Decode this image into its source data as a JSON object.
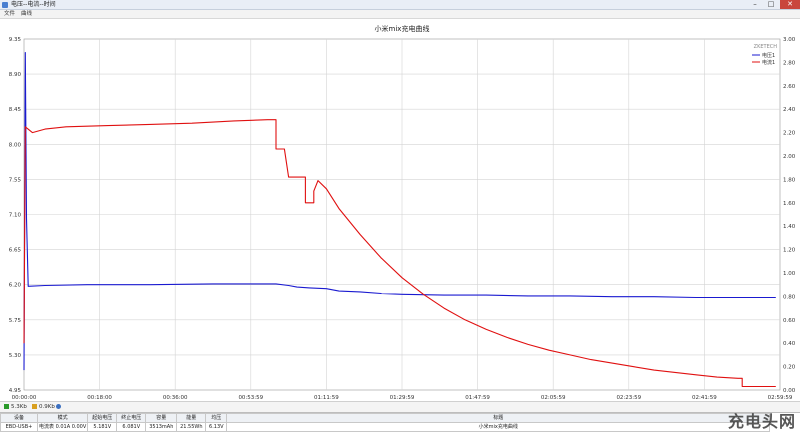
{
  "window": {
    "title": "电压--电流--时间",
    "close_glyph": "✕",
    "minimize_glyph": "–",
    "maximize_glyph": "□"
  },
  "menu": {
    "items": [
      "文件",
      "曲线"
    ]
  },
  "chart_data": {
    "type": "line",
    "title": "小米mix充电曲线",
    "brand": "ZKETECH",
    "x_ticks": [
      "00:00:00",
      "00:18:00",
      "00:36:00",
      "00:53:59",
      "01:11:59",
      "01:29:59",
      "01:47:59",
      "02:05:59",
      "02:23:59",
      "02:41:59",
      "02:59:59"
    ],
    "xlim_minutes": [
      0,
      180
    ],
    "y_left": {
      "ticks": [
        "9.35",
        "8.90",
        "8.45",
        "8.00",
        "7.55",
        "7.10",
        "6.65",
        "6.20",
        "5.75",
        "5.30",
        "4.95"
      ],
      "ylim": [
        4.95,
        9.35
      ]
    },
    "y_right": {
      "ticks": [
        "3.00",
        "2.80",
        "2.60",
        "2.40",
        "2.20",
        "2.00",
        "1.80",
        "1.60",
        "1.40",
        "1.20",
        "1.00",
        "0.80",
        "0.60",
        "0.40",
        "0.20",
        "0.00"
      ],
      "ylim": [
        0,
        3.0
      ]
    },
    "grid": true,
    "legend_position": "top-right",
    "series": [
      {
        "name": "电压1",
        "axis": "left",
        "color": "#1a1ad0",
        "points": [
          [
            0,
            5.2
          ],
          [
            0.3,
            9.18
          ],
          [
            0.6,
            7.1
          ],
          [
            1,
            6.25
          ],
          [
            5,
            6.26
          ],
          [
            15,
            6.27
          ],
          [
            30,
            6.27
          ],
          [
            45,
            6.28
          ],
          [
            55,
            6.28
          ],
          [
            60,
            6.28
          ],
          [
            63,
            6.26
          ],
          [
            65,
            6.24
          ],
          [
            68,
            6.23
          ],
          [
            72,
            6.22
          ],
          [
            75,
            6.19
          ],
          [
            80,
            6.18
          ],
          [
            85,
            6.16
          ],
          [
            90,
            6.15
          ],
          [
            100,
            6.14
          ],
          [
            110,
            6.14
          ],
          [
            120,
            6.13
          ],
          [
            130,
            6.13
          ],
          [
            140,
            6.12
          ],
          [
            150,
            6.12
          ],
          [
            160,
            6.11
          ],
          [
            170,
            6.11
          ],
          [
            179,
            6.11
          ]
        ]
      },
      {
        "name": "电流1",
        "axis": "right",
        "color": "#e01010",
        "points": [
          [
            0,
            0.4
          ],
          [
            0.3,
            2.25
          ],
          [
            2,
            2.2
          ],
          [
            5,
            2.23
          ],
          [
            10,
            2.25
          ],
          [
            20,
            2.26
          ],
          [
            30,
            2.27
          ],
          [
            40,
            2.28
          ],
          [
            50,
            2.3
          ],
          [
            58,
            2.31
          ],
          [
            60,
            2.31
          ],
          [
            60,
            2.06
          ],
          [
            62,
            2.06
          ],
          [
            63,
            1.82
          ],
          [
            67,
            1.82
          ],
          [
            67,
            1.6
          ],
          [
            69,
            1.6
          ],
          [
            69,
            1.7
          ],
          [
            70,
            1.79
          ],
          [
            72,
            1.72
          ],
          [
            75,
            1.55
          ],
          [
            80,
            1.33
          ],
          [
            85,
            1.13
          ],
          [
            90,
            0.96
          ],
          [
            95,
            0.82
          ],
          [
            100,
            0.7
          ],
          [
            105,
            0.6
          ],
          [
            110,
            0.52
          ],
          [
            115,
            0.45
          ],
          [
            120,
            0.39
          ],
          [
            125,
            0.34
          ],
          [
            130,
            0.3
          ],
          [
            135,
            0.26
          ],
          [
            140,
            0.23
          ],
          [
            145,
            0.2
          ],
          [
            150,
            0.17
          ],
          [
            155,
            0.15
          ],
          [
            160,
            0.13
          ],
          [
            165,
            0.11
          ],
          [
            170,
            0.1
          ],
          [
            171,
            0.1
          ],
          [
            171,
            0.03
          ],
          [
            179,
            0.03
          ]
        ]
      }
    ]
  },
  "status": {
    "left_rate": "5.3Kb",
    "right_rate": "0.9Kb"
  },
  "info": {
    "headers": [
      "设备",
      "模式",
      "起始电压",
      "终止电压",
      "容量",
      "能量",
      "均压",
      "标题"
    ],
    "values": [
      "EBD-USB+",
      "电流表 0.01A 0.00V",
      "5.181V",
      "6.081V",
      "3513mAh",
      "21.55Wh",
      "6.13V",
      "小米mix充电曲线"
    ]
  },
  "watermark": "充电头网"
}
